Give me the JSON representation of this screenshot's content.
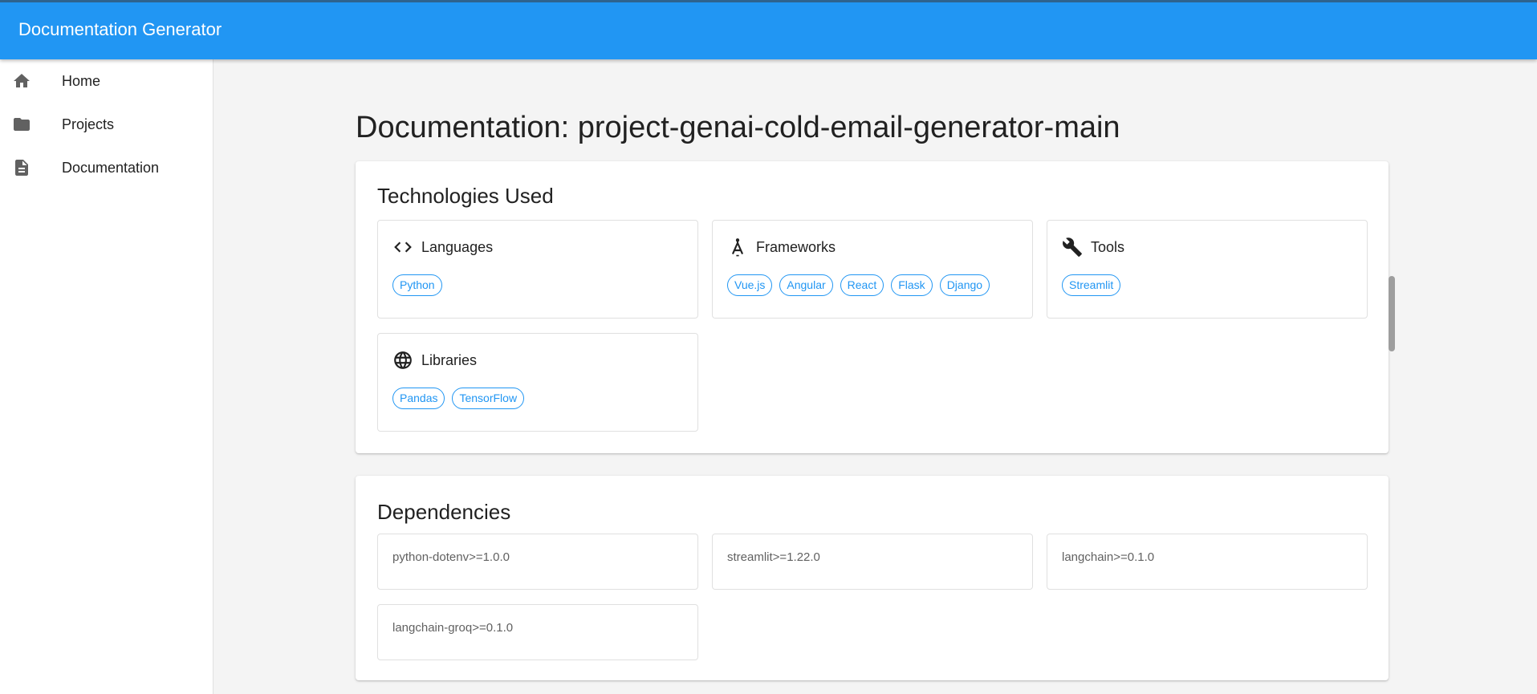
{
  "app": {
    "title": "Documentation Generator"
  },
  "sidebar": {
    "items": [
      {
        "label": "Home",
        "icon": "home-icon"
      },
      {
        "label": "Projects",
        "icon": "folder-icon"
      },
      {
        "label": "Documentation",
        "icon": "document-icon"
      }
    ]
  },
  "main": {
    "title": "Documentation: project-genai-cold-email-generator-main",
    "technologies": {
      "title": "Technologies Used",
      "categories": [
        {
          "label": "Languages",
          "icon": "code-icon",
          "chips": [
            "Python"
          ]
        },
        {
          "label": "Frameworks",
          "icon": "compass-icon",
          "chips": [
            "Vue.js",
            "Angular",
            "React",
            "Flask",
            "Django"
          ]
        },
        {
          "label": "Tools",
          "icon": "wrench-icon",
          "chips": [
            "Streamlit"
          ]
        },
        {
          "label": "Libraries",
          "icon": "globe-icon",
          "chips": [
            "Pandas",
            "TensorFlow"
          ]
        }
      ]
    },
    "dependencies": {
      "title": "Dependencies",
      "items": [
        "python-dotenv>=1.0.0",
        "streamlit>=1.22.0",
        "langchain>=0.1.0",
        "langchain-groq>=0.1.0"
      ]
    }
  },
  "colors": {
    "primary": "#2196f3",
    "chip": "#2196f3",
    "icon": "#616161"
  }
}
